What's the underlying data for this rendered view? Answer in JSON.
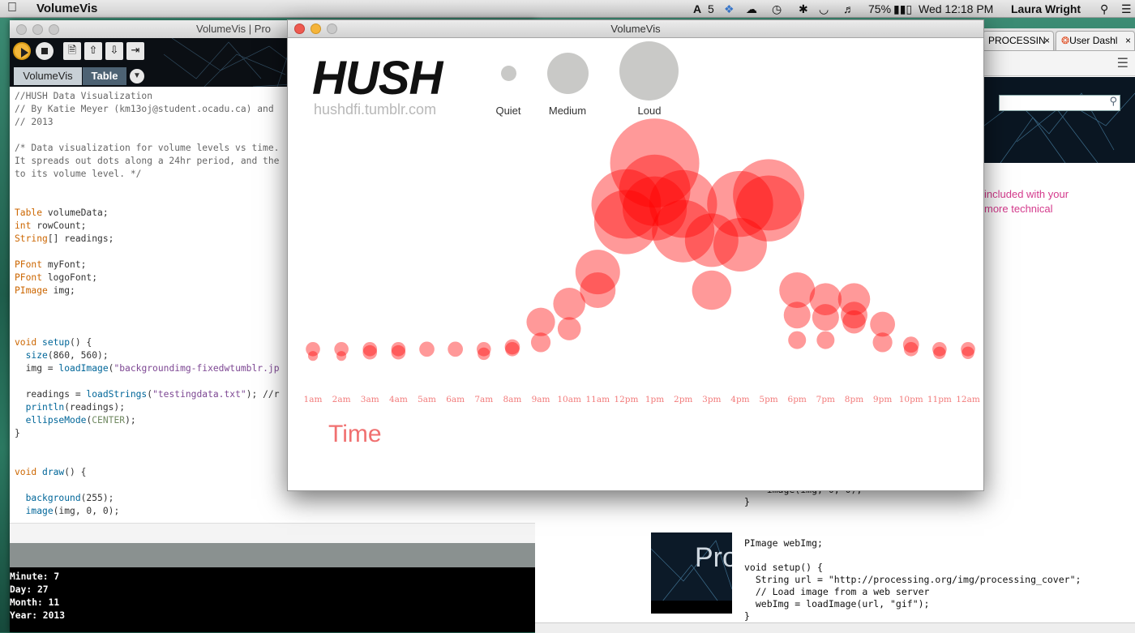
{
  "menubar": {
    "apple": "",
    "app_name": "VolumeVis",
    "battery_percent": "75%",
    "clock": "Wed 12:18 PM",
    "user": "Laura Wright",
    "adobe_badge": "5"
  },
  "editor": {
    "title": "VolumeVis | Pro",
    "tabs": [
      "VolumeVis",
      "Table"
    ],
    "code_lines": [
      "//HUSH Data Visualization",
      "// By Katie Meyer (km13oj@student.ocadu.ca) and",
      "// 2013",
      "",
      "/* Data visualization for volume levels vs time.",
      "It spreads out dots along a 24hr period, and the",
      "to its volume level. */",
      "",
      "",
      "Table volumeData;",
      "int rowCount;",
      "String[] readings;",
      "",
      "PFont myFont;",
      "PFont logoFont;",
      "PImage img;",
      "",
      "",
      "",
      "void setup() {",
      "  size(860, 560);",
      "  img = loadImage(\"backgroundimg-fixedwtumblr.jp",
      "",
      "  readings = loadStrings(\"testingdata.txt\"); //r",
      "  println(readings);",
      "  ellipseMode(CENTER);",
      "}",
      "",
      "",
      "void draw() {",
      "",
      "  background(255);",
      "  image(img, 0, 0);"
    ],
    "console_lines": [
      "Minute: 7",
      "Day: 27",
      "Month: 11",
      "Year: 2013"
    ]
  },
  "browser": {
    "tabs": [
      "PROCESSIN",
      "User Dashl"
    ],
    "pink_text": "included with your\nmore technical",
    "code_top": "    image(img, 0, 0);\n}",
    "code_block": "PImage webImg;\n\nvoid setup() {\n  String url = \"http://processing.org/img/processing_cover\";\n  // Load image from a web server\n  webImg = loadImage(url, \"gif\");\n}",
    "thumb_text": "Pro"
  },
  "sketch": {
    "window_title": "VolumeVis",
    "logo": "HUSH",
    "logo_url": "hushdfi.tumblr.com",
    "legend": [
      "Quiet",
      "Medium",
      "Loud"
    ],
    "axis_title": "Time"
  },
  "colors": {
    "dot_fill": "#ff0000",
    "hour_label": "#f27b7b",
    "time_label": "#f07070",
    "legend_grey": "#c9c9c7"
  },
  "chart_data": {
    "type": "scatter",
    "x_label": "Time",
    "x_ticks": [
      "1am",
      "2am",
      "3am",
      "4am",
      "5am",
      "6am",
      "7am",
      "8am",
      "9am",
      "10am",
      "11am",
      "12pm",
      "1pm",
      "2pm",
      "3pm",
      "4pm",
      "5pm",
      "6pm",
      "7pm",
      "8pm",
      "9pm",
      "10pm",
      "11pm",
      "12am"
    ],
    "size_scale": {
      "Quiet": 1,
      "Medium": 3,
      "Loud": 4.5
    },
    "series": [
      {
        "name": "",
        "points": [
          {
            "hour": "1am",
            "level": 0.2,
            "volume": 0.8
          },
          {
            "hour": "1am",
            "level": 0.05,
            "volume": 0.55
          },
          {
            "hour": "2am",
            "level": 0.2,
            "volume": 0.8
          },
          {
            "hour": "2am",
            "level": 0.05,
            "volume": 0.55
          },
          {
            "hour": "3am",
            "level": 0.2,
            "volume": 0.8
          },
          {
            "hour": "3am",
            "level": 0.13,
            "volume": 0.8
          },
          {
            "hour": "4am",
            "level": 0.2,
            "volume": 0.8
          },
          {
            "hour": "4am",
            "level": 0.13,
            "volume": 0.8
          },
          {
            "hour": "5am",
            "level": 0.2,
            "volume": 0.85
          },
          {
            "hour": "6am",
            "level": 0.2,
            "volume": 0.85
          },
          {
            "hour": "7am",
            "level": 0.2,
            "volume": 0.8
          },
          {
            "hour": "7am",
            "level": 0.1,
            "volume": 0.7
          },
          {
            "hour": "8am",
            "level": 0.25,
            "volume": 0.85
          },
          {
            "hour": "8am",
            "level": 0.2,
            "volume": 0.8
          },
          {
            "hour": "9am",
            "level": 0.8,
            "volume": 1.6
          },
          {
            "hour": "9am",
            "level": 0.35,
            "volume": 1.1
          },
          {
            "hour": "10am",
            "level": 1.2,
            "volume": 1.8
          },
          {
            "hour": "10am",
            "level": 0.65,
            "volume": 1.3
          },
          {
            "hour": "11am",
            "level": 1.9,
            "volume": 2.5
          },
          {
            "hour": "11am",
            "level": 1.5,
            "volume": 2.0
          },
          {
            "hour": "12pm",
            "level": 3.4,
            "volume": 3.9
          },
          {
            "hour": "12pm",
            "level": 3.0,
            "volume": 3.6
          },
          {
            "hour": "1pm",
            "level": 4.3,
            "volume": 5.0
          },
          {
            "hour": "1pm",
            "level": 3.7,
            "volume": 4.0
          },
          {
            "hour": "1pm",
            "level": 3.3,
            "volume": 3.6
          },
          {
            "hour": "2pm",
            "level": 3.4,
            "volume": 3.8
          },
          {
            "hour": "2pm",
            "level": 2.8,
            "volume": 3.5
          },
          {
            "hour": "3pm",
            "level": 2.6,
            "volume": 3.0
          },
          {
            "hour": "3pm",
            "level": 1.5,
            "volume": 2.2
          },
          {
            "hour": "4pm",
            "level": 3.4,
            "volume": 3.7
          },
          {
            "hour": "4pm",
            "level": 2.5,
            "volume": 3.0
          },
          {
            "hour": "5pm",
            "level": 3.6,
            "volume": 4.0
          },
          {
            "hour": "5pm",
            "level": 3.3,
            "volume": 3.7
          },
          {
            "hour": "6pm",
            "level": 1.5,
            "volume": 2.0
          },
          {
            "hour": "6pm",
            "level": 0.95,
            "volume": 1.5
          },
          {
            "hour": "6pm",
            "level": 0.4,
            "volume": 1.0
          },
          {
            "hour": "7pm",
            "level": 1.3,
            "volume": 1.8
          },
          {
            "hour": "7pm",
            "level": 0.9,
            "volume": 1.5
          },
          {
            "hour": "7pm",
            "level": 0.4,
            "volume": 1.0
          },
          {
            "hour": "8pm",
            "level": 1.3,
            "volume": 1.8
          },
          {
            "hour": "8pm",
            "level": 0.95,
            "volume": 1.5
          },
          {
            "hour": "8pm",
            "level": 0.8,
            "volume": 1.3
          },
          {
            "hour": "9pm",
            "level": 0.75,
            "volume": 1.4
          },
          {
            "hour": "9pm",
            "level": 0.35,
            "volume": 1.1
          },
          {
            "hour": "10pm",
            "level": 0.3,
            "volume": 0.9
          },
          {
            "hour": "10pm",
            "level": 0.2,
            "volume": 0.8
          },
          {
            "hour": "11pm",
            "level": 0.2,
            "volume": 0.8
          },
          {
            "hour": "11pm",
            "level": 0.12,
            "volume": 0.7
          },
          {
            "hour": "12am",
            "level": 0.2,
            "volume": 0.8
          },
          {
            "hour": "12am",
            "level": 0.12,
            "volume": 0.7
          }
        ]
      }
    ]
  }
}
